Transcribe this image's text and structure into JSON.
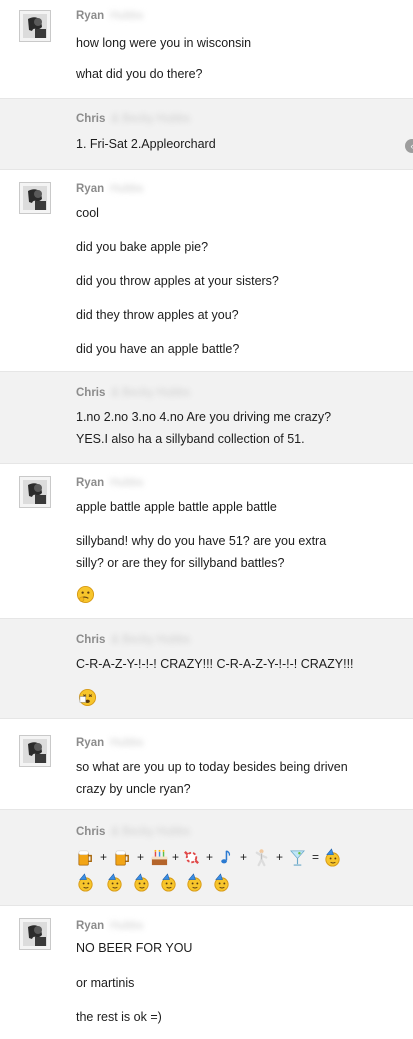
{
  "messages": [
    {
      "sender": "Ryan",
      "surname": "Hubbs",
      "lines": [
        "how long were you in wisconsin",
        "what did you do there?"
      ]
    },
    {
      "sender": "Chris",
      "surname": "& Becky Hubbs",
      "lines": [
        "1. Fri-Sat 2.Appleorchard"
      ]
    },
    {
      "sender": "Ryan",
      "surname": "Hubbs",
      "lines": [
        "cool",
        "did you bake apple pie?",
        "did you throw apples at your sisters?",
        "did they throw apples at you?",
        "did you have an apple battle?"
      ]
    },
    {
      "sender": "Chris",
      "surname": "& Becky Hubbs",
      "lines": [
        "1.no 2.no 3.no 4.no Are you driving me crazy?",
        "YES.I also ha a sillyband collection of 51."
      ]
    },
    {
      "sender": "Ryan",
      "surname": "Hubbs",
      "lines": [
        "apple battle apple battle apple battle",
        "sillyband! why do you have 51? are you extra",
        "silly? or are they for sillyband battles?"
      ],
      "emoji": "thinking-face"
    },
    {
      "sender": "Chris",
      "surname": "& Becky Hubbs",
      "lines": [
        "C-R-A-Z-Y-!-!-! CRAZY!!! C-R-A-Z-Y-!-!-! CRAZY!!!"
      ],
      "emoji": "dizzy-face"
    },
    {
      "sender": "Ryan",
      "surname": "Hubbs",
      "lines": [
        "so what are you up to today besides being driven",
        "crazy by uncle ryan?"
      ]
    },
    {
      "sender": "Chris",
      "surname": "& Becky Hubbs",
      "plus": "+",
      "equals": "=",
      "equation": [
        "beer-mug",
        "beer-mug-2",
        "birthday-cake",
        "candy",
        "music-note",
        "dancer",
        "cocktail"
      ],
      "result": "party-face",
      "result_row": [
        "party-face",
        "party-face",
        "party-face",
        "party-face",
        "party-face",
        "party-face"
      ]
    },
    {
      "sender": "Ryan",
      "surname": "Hubbs",
      "lines": [
        "NO BEER FOR YOU",
        "or martinis",
        "the rest is ok =)"
      ]
    }
  ],
  "scroll_indicator": "‹"
}
